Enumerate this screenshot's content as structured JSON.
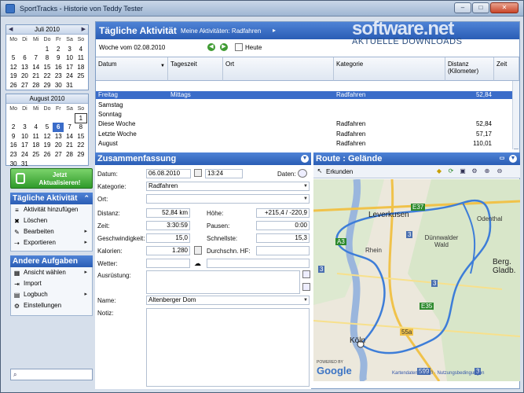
{
  "window": {
    "title": "SportTracks - Historie von Teddy Tester",
    "min": "–",
    "max": "□",
    "close": "✕"
  },
  "calendar_july": {
    "title": "Juli 2010",
    "dow": [
      "Mo",
      "Di",
      "Mi",
      "Do",
      "Fr",
      "Sa",
      "So"
    ],
    "days": [
      "",
      "",
      "",
      "1",
      "2",
      "3",
      "4",
      "5",
      "6",
      "7",
      "8",
      "9",
      "10",
      "11",
      "12",
      "13",
      "14",
      "15",
      "16",
      "17",
      "18",
      "19",
      "20",
      "21",
      "22",
      "23",
      "24",
      "25",
      "26",
      "27",
      "28",
      "29",
      "30",
      "31",
      ""
    ]
  },
  "calendar_aug": {
    "title": "August 2010",
    "dow": [
      "Mo",
      "Di",
      "Mi",
      "Do",
      "Fr",
      "Sa",
      "So"
    ],
    "days": [
      "",
      "",
      "",
      "",
      "",
      "",
      "1",
      "2",
      "3",
      "4",
      "5",
      "6",
      "7",
      "8",
      "9",
      "10",
      "11",
      "12",
      "13",
      "14",
      "15",
      "16",
      "17",
      "18",
      "19",
      "20",
      "21",
      "22",
      "23",
      "24",
      "25",
      "26",
      "27",
      "28",
      "29",
      "30",
      "31",
      "",
      "",
      "",
      "",
      ""
    ],
    "selected": "6"
  },
  "update_button": {
    "line1": "Jetzt",
    "line2": "Aktualisieren!"
  },
  "panel_daily": {
    "title": "Tägliche Aktivität",
    "collapse": "⌃",
    "items": [
      {
        "label": "Aktivität hinzufügen",
        "icon": "≡"
      },
      {
        "label": "Löschen",
        "icon": "✖"
      },
      {
        "label": "Bearbeiten",
        "icon": "✎",
        "arrow": "▸"
      },
      {
        "label": "Exportieren",
        "icon": "⇢",
        "arrow": "▸"
      }
    ]
  },
  "panel_other": {
    "title": "Andere Aufgaben",
    "items": [
      {
        "label": "Ansicht wählen",
        "icon": "▦",
        "arrow": "▸"
      },
      {
        "label": "Import",
        "icon": "⇥"
      },
      {
        "label": "Logbuch",
        "icon": "▤",
        "arrow": "▸"
      },
      {
        "label": "Einstellungen",
        "icon": "⚙"
      }
    ]
  },
  "search": {
    "icon": "🔍",
    "value": ""
  },
  "main_header": {
    "title": "Tägliche Aktivität",
    "crumb": "Meine Aktivitäten: Radfahren",
    "arrow": "▸"
  },
  "watermark": {
    "line1": "software.net",
    "line2": "AKTUELLE DOWNLOADS"
  },
  "weekbar": {
    "week": "Woche vom 02.08.2010",
    "heute": "Heute"
  },
  "table": {
    "headers": [
      "Datum",
      "Tageszeit",
      "Ort",
      "Kategorie",
      "Distanz (Kilometer)",
      "Zeit"
    ],
    "rows": [
      {
        "datum": "",
        "tageszeit": "",
        "kategorie": "",
        "distanz": "",
        "sel": false
      },
      {
        "datum": "Freitag",
        "tageszeit": "Mittags",
        "kategorie": "Radfahren",
        "distanz": "52,84",
        "sel": true
      },
      {
        "datum": "Samstag",
        "tageszeit": "",
        "kategorie": "",
        "distanz": "",
        "sel": false
      },
      {
        "datum": "Sonntag",
        "tageszeit": "",
        "kategorie": "",
        "distanz": "",
        "sel": false
      },
      {
        "datum": "Diese Woche",
        "tageszeit": "",
        "kategorie": "Radfahren",
        "distanz": "52,84",
        "sel": false
      },
      {
        "datum": "Letzte Woche",
        "tageszeit": "",
        "kategorie": "Radfahren",
        "distanz": "57,17",
        "sel": false
      },
      {
        "datum": "August",
        "tageszeit": "",
        "kategorie": "Radfahren",
        "distanz": "110,01",
        "sel": false
      },
      {
        "datum": "Juli",
        "tageszeit": "",
        "kategorie": "",
        "distanz": "",
        "sel": false
      }
    ]
  },
  "summary": {
    "title": "Zusammenfassung",
    "datum_label": "Datum:",
    "datum": "06.08.2010",
    "zeit_val": "13:24",
    "daten": "Daten:",
    "kategorie_label": "Kategorie:",
    "kategorie": "Radfahren",
    "ort_label": "Ort:",
    "distanz_label": "Distanz:",
    "distanz": "52,84 km",
    "hoehe_label": "Höhe:",
    "hoehe": "+215,4 / -220,9",
    "zeit_label": "Zeit:",
    "zeit": "3:30:59",
    "pausen_label": "Pausen:",
    "pausen": "0:00",
    "geschw_label": "Geschwindigkeit:",
    "geschw": "15,0",
    "schnell_label": "Schnellste:",
    "schnell": "15,3",
    "kalorien_label": "Kalorien:",
    "kalorien": "1.280",
    "hf_label": "Durchschn. HF:",
    "wetter_label": "Wetter:",
    "ausruestung_label": "Ausrüstung:",
    "name_label": "Name:",
    "name": "Altenberger Dom",
    "notiz_label": "Notiz:"
  },
  "route": {
    "title": "Route : Gelände",
    "erkunden": "Erkunden",
    "places": [
      "Leverkusen",
      "Odenthal",
      "Rhein",
      "Dünnwalder Wald",
      "Berg. Gladb.",
      "Köln"
    ],
    "roads": [
      "E37",
      "A3",
      "E35",
      "3",
      "3",
      "55a",
      "3",
      "599",
      "3"
    ],
    "footer": "Kartendaten ©2010 · Nutzungsbedingungen",
    "powered": "POWERED BY",
    "google": "Google"
  }
}
